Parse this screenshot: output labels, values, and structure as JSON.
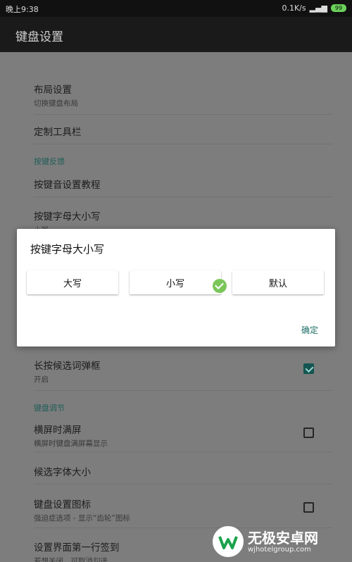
{
  "status_bar": {
    "time": "晚上9:38",
    "network_speed": "0.1K/s",
    "battery": "99"
  },
  "app_bar": {
    "title": "键盘设置"
  },
  "settings": {
    "layout": {
      "title": "布局设置",
      "subtitle": "切换键盘布局"
    },
    "toolbar": {
      "title": "定制工具栏"
    },
    "section_feedback": "按键反馈",
    "tutorial": {
      "title": "按键音设置教程"
    },
    "case": {
      "title": "按键字母大小写",
      "subtitle": "小写"
    },
    "longpress": {
      "title": "长按候选词弹框",
      "subtitle": "开启",
      "checked": true
    },
    "section_adjust": "键盘调节",
    "fullscreen": {
      "title": "横屏时满屏",
      "subtitle": "横屏时键盘满屏幕显示",
      "checked": false
    },
    "font_size": {
      "title": "候选字体大小"
    },
    "gear_icon": {
      "title": "键盘设置图标",
      "subtitle": "强迫症选项 - 显示“齿轮”图标",
      "checked": false
    },
    "signin": {
      "title": "设置界面第一行签到",
      "subtitle": "若想关闭，可取消勾选"
    }
  },
  "dialog": {
    "title": "按键字母大小写",
    "options": [
      "大写",
      "小写",
      "默认"
    ],
    "selected": "小写",
    "confirm": "确定"
  },
  "watermark": {
    "name": "无极安卓网",
    "url": "wjhotelgroup.com"
  }
}
